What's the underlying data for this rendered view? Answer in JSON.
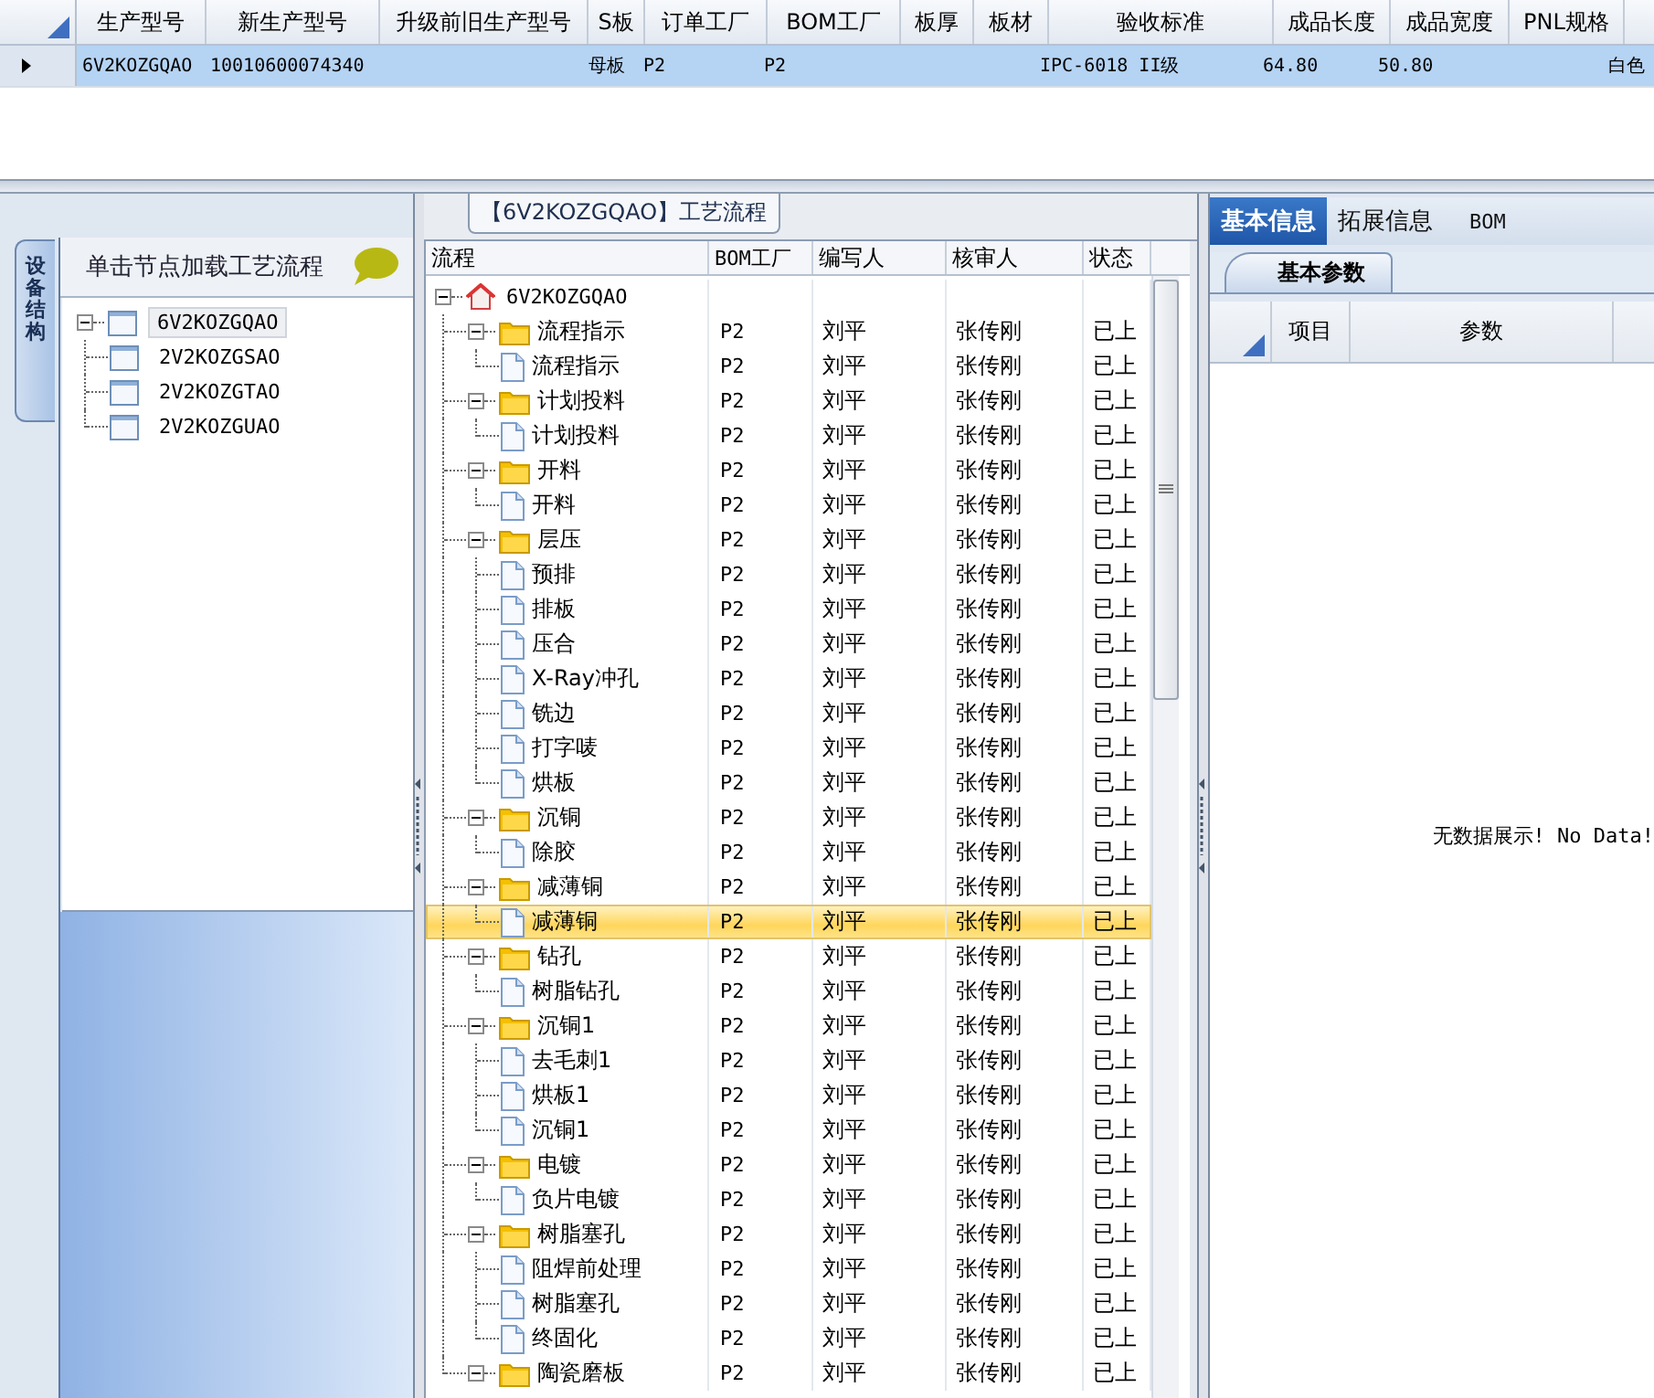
{
  "grid": {
    "columns": [
      "生产型号",
      "新生产型号",
      "升级前旧生产型号",
      "S板",
      "订单工厂",
      "BOM工厂",
      "板厚",
      "板材",
      "验收标准",
      "成品长度",
      "成品宽度",
      "PNL规格"
    ],
    "rows": [
      {
        "selected": true,
        "cells": [
          "6V2KOZGQAO",
          "10010600074340",
          "",
          "母板",
          "P2",
          "P2",
          "",
          "",
          "IPC-6018 II级",
          "64.80",
          "50.80",
          "",
          "白色"
        ]
      }
    ]
  },
  "left_panel": {
    "tab": "设备结构",
    "hint": "单击节点加载工艺流程",
    "tree": {
      "label": "6V2KOZGQAO",
      "selected": true,
      "expanded": true,
      "children": [
        {
          "label": "2V2KOZGSAO",
          "selected": false
        },
        {
          "label": "2V2KOZGTAO",
          "selected": false
        },
        {
          "label": "2V2KOZGUAO",
          "selected": false
        }
      ]
    }
  },
  "flow": {
    "title": "【6V2KOZGQAO】工艺流程",
    "columns": [
      "流程",
      "BOM工厂",
      "编写人",
      "核审人",
      "状态"
    ],
    "tree": {
      "label": "6V2KOZGQAO",
      "kind": "root",
      "expanded": true,
      "selected": false,
      "children": [
        {
          "label": "流程指示",
          "kind": "folder",
          "expanded": true,
          "selected": false,
          "bom": "P2",
          "writer": "刘平",
          "reviewer": "张传刚",
          "status": "已上",
          "children": [
            {
              "label": "流程指示",
              "kind": "step",
              "selected": false,
              "bom": "P2",
              "writer": "刘平",
              "reviewer": "张传刚",
              "status": "已上"
            }
          ]
        },
        {
          "label": "计划投料",
          "kind": "folder",
          "expanded": true,
          "selected": false,
          "bom": "P2",
          "writer": "刘平",
          "reviewer": "张传刚",
          "status": "已上",
          "children": [
            {
              "label": "计划投料",
              "kind": "step",
              "selected": false,
              "bom": "P2",
              "writer": "刘平",
              "reviewer": "张传刚",
              "status": "已上"
            }
          ]
        },
        {
          "label": "开料",
          "kind": "folder",
          "expanded": true,
          "selected": false,
          "bom": "P2",
          "writer": "刘平",
          "reviewer": "张传刚",
          "status": "已上",
          "children": [
            {
              "label": "开料",
              "kind": "step",
              "selected": false,
              "bom": "P2",
              "writer": "刘平",
              "reviewer": "张传刚",
              "status": "已上"
            }
          ]
        },
        {
          "label": "层压",
          "kind": "folder",
          "expanded": true,
          "selected": false,
          "bom": "P2",
          "writer": "刘平",
          "reviewer": "张传刚",
          "status": "已上",
          "children": [
            {
              "label": "预排",
              "kind": "step",
              "selected": false,
              "bom": "P2",
              "writer": "刘平",
              "reviewer": "张传刚",
              "status": "已上"
            },
            {
              "label": "排板",
              "kind": "step",
              "selected": false,
              "bom": "P2",
              "writer": "刘平",
              "reviewer": "张传刚",
              "status": "已上"
            },
            {
              "label": "压合",
              "kind": "step",
              "selected": false,
              "bom": "P2",
              "writer": "刘平",
              "reviewer": "张传刚",
              "status": "已上"
            },
            {
              "label": "X-Ray冲孔",
              "kind": "step",
              "selected": false,
              "bom": "P2",
              "writer": "刘平",
              "reviewer": "张传刚",
              "status": "已上"
            },
            {
              "label": "铣边",
              "kind": "step",
              "selected": false,
              "bom": "P2",
              "writer": "刘平",
              "reviewer": "张传刚",
              "status": "已上"
            },
            {
              "label": "打字唛",
              "kind": "step",
              "selected": false,
              "bom": "P2",
              "writer": "刘平",
              "reviewer": "张传刚",
              "status": "已上"
            },
            {
              "label": "烘板",
              "kind": "step",
              "selected": false,
              "bom": "P2",
              "writer": "刘平",
              "reviewer": "张传刚",
              "status": "已上"
            }
          ]
        },
        {
          "label": "沉铜",
          "kind": "folder",
          "expanded": true,
          "selected": false,
          "bom": "P2",
          "writer": "刘平",
          "reviewer": "张传刚",
          "status": "已上",
          "children": [
            {
              "label": "除胶",
              "kind": "step",
              "selected": false,
              "bom": "P2",
              "writer": "刘平",
              "reviewer": "张传刚",
              "status": "已上"
            }
          ]
        },
        {
          "label": "减薄铜",
          "kind": "folder",
          "expanded": true,
          "selected": false,
          "bom": "P2",
          "writer": "刘平",
          "reviewer": "张传刚",
          "status": "已上",
          "children": [
            {
              "label": "减薄铜",
              "kind": "step",
              "selected": true,
              "bom": "P2",
              "writer": "刘平",
              "reviewer": "张传刚",
              "status": "已上"
            }
          ]
        },
        {
          "label": "钻孔",
          "kind": "folder",
          "expanded": true,
          "selected": false,
          "bom": "P2",
          "writer": "刘平",
          "reviewer": "张传刚",
          "status": "已上",
          "children": [
            {
              "label": "树脂钻孔",
              "kind": "step",
              "selected": false,
              "bom": "P2",
              "writer": "刘平",
              "reviewer": "张传刚",
              "status": "已上"
            }
          ]
        },
        {
          "label": "沉铜1",
          "kind": "folder",
          "expanded": true,
          "selected": false,
          "bom": "P2",
          "writer": "刘平",
          "reviewer": "张传刚",
          "status": "已上",
          "children": [
            {
              "label": "去毛刺1",
              "kind": "step",
              "selected": false,
              "bom": "P2",
              "writer": "刘平",
              "reviewer": "张传刚",
              "status": "已上"
            },
            {
              "label": "烘板1",
              "kind": "step",
              "selected": false,
              "bom": "P2",
              "writer": "刘平",
              "reviewer": "张传刚",
              "status": "已上"
            },
            {
              "label": "沉铜1",
              "kind": "step",
              "selected": false,
              "bom": "P2",
              "writer": "刘平",
              "reviewer": "张传刚",
              "status": "已上"
            }
          ]
        },
        {
          "label": "电镀",
          "kind": "folder",
          "expanded": true,
          "selected": false,
          "bom": "P2",
          "writer": "刘平",
          "reviewer": "张传刚",
          "status": "已上",
          "children": [
            {
              "label": "负片电镀",
              "kind": "step",
              "selected": false,
              "bom": "P2",
              "writer": "刘平",
              "reviewer": "张传刚",
              "status": "已上"
            }
          ]
        },
        {
          "label": "树脂塞孔",
          "kind": "folder",
          "expanded": true,
          "selected": false,
          "bom": "P2",
          "writer": "刘平",
          "reviewer": "张传刚",
          "status": "已上",
          "children": [
            {
              "label": "阻焊前处理",
              "kind": "step",
              "selected": false,
              "bom": "P2",
              "writer": "刘平",
              "reviewer": "张传刚",
              "status": "已上"
            },
            {
              "label": "树脂塞孔",
              "kind": "step",
              "selected": false,
              "bom": "P2",
              "writer": "刘平",
              "reviewer": "张传刚",
              "status": "已上"
            },
            {
              "label": "终固化",
              "kind": "step",
              "selected": false,
              "bom": "P2",
              "writer": "刘平",
              "reviewer": "张传刚",
              "status": "已上"
            }
          ]
        },
        {
          "label": "陶瓷磨板",
          "kind": "folder",
          "expanded": true,
          "selected": false,
          "bom": "P2",
          "writer": "刘平",
          "reviewer": "张传刚",
          "status": "已上"
        }
      ]
    }
  },
  "detail": {
    "tabs": [
      {
        "label": "基本信息",
        "selected": true
      },
      {
        "label": "拓展信息",
        "selected": false
      },
      {
        "label": "BOM",
        "selected": false
      }
    ],
    "subtabs": [
      {
        "label": "基本参数",
        "selected": true
      }
    ],
    "columns": [
      "项目",
      "参数"
    ],
    "empty": "无数据展示! No Data!"
  }
}
